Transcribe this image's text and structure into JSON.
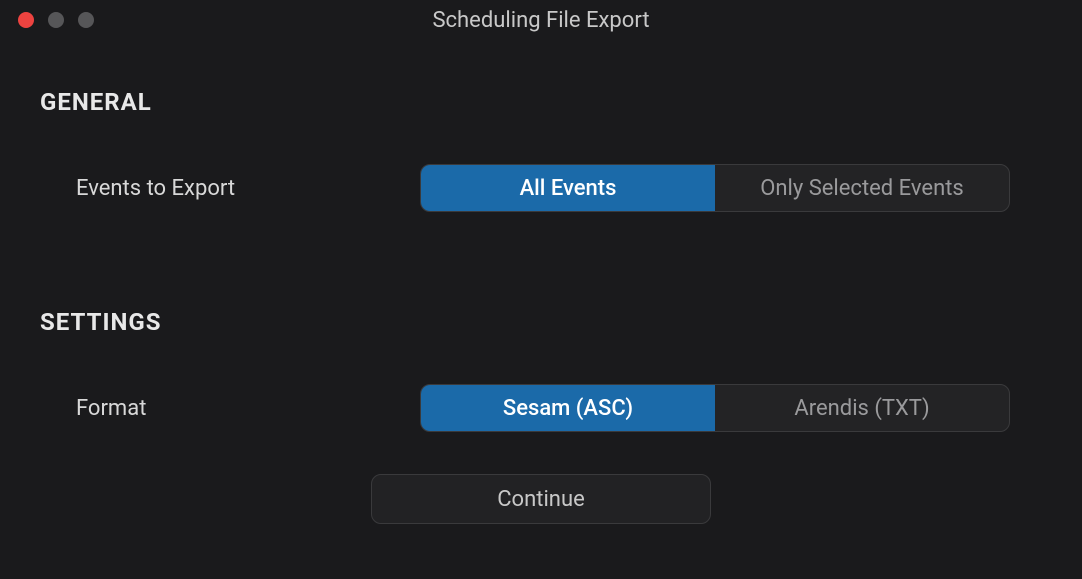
{
  "window": {
    "title": "Scheduling File Export"
  },
  "sections": {
    "general": {
      "heading": "GENERAL",
      "events": {
        "label": "Events to Export",
        "options": {
          "all": "All Events",
          "selected": "Only Selected Events"
        }
      }
    },
    "settings": {
      "heading": "SETTINGS",
      "format": {
        "label": "Format",
        "options": {
          "sesam": "Sesam (ASC)",
          "arendis": "Arendis (TXT)"
        }
      }
    }
  },
  "actions": {
    "continue": "Continue"
  }
}
